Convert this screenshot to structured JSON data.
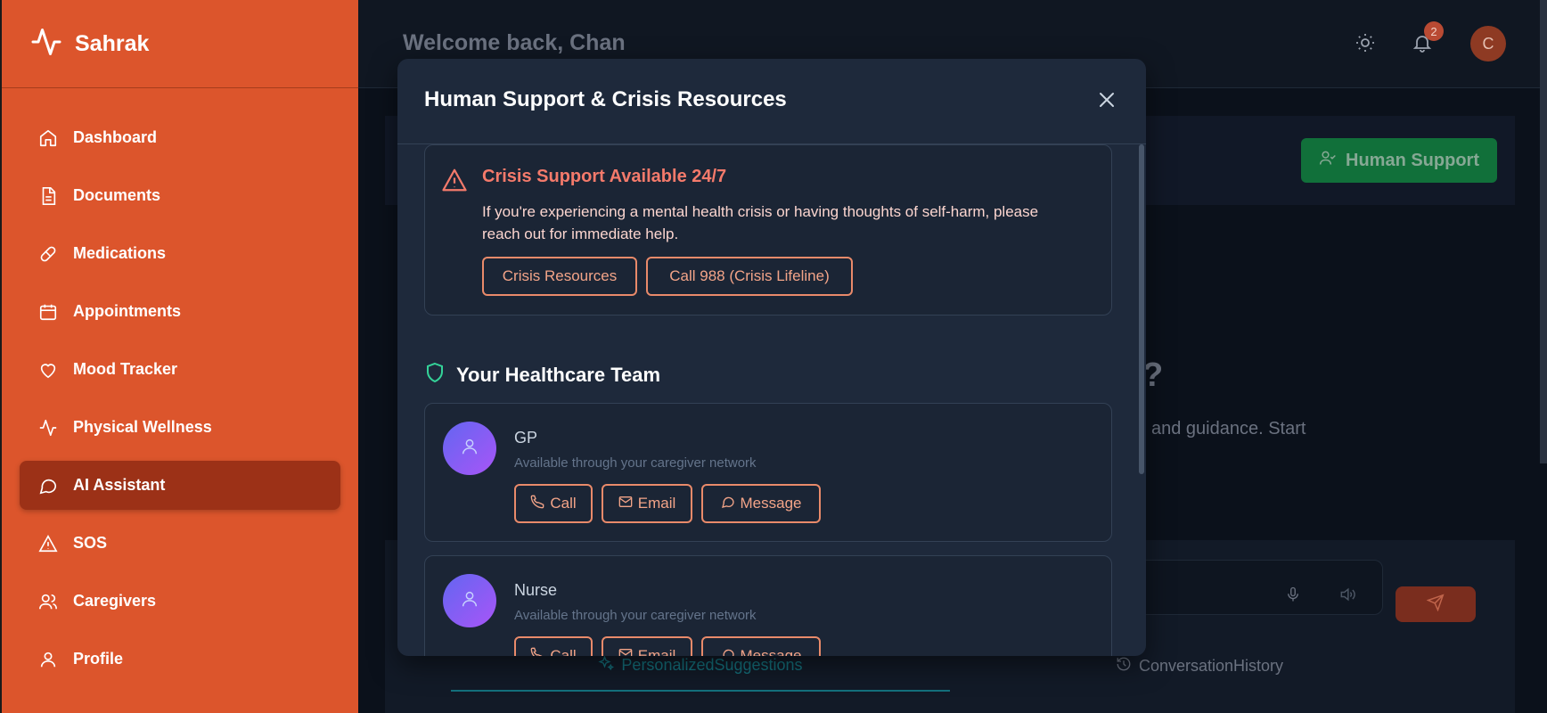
{
  "brand": {
    "name": "Sahrak",
    "icon": "pulse-icon"
  },
  "sidebar": {
    "items": [
      {
        "label": "Dashboard",
        "icon": "home-icon",
        "active": false
      },
      {
        "label": "Documents",
        "icon": "document-icon",
        "active": false
      },
      {
        "label": "Medications",
        "icon": "pill-icon",
        "active": false
      },
      {
        "label": "Appointments",
        "icon": "calendar-icon",
        "active": false
      },
      {
        "label": "Mood Tracker",
        "icon": "heart-icon",
        "active": false
      },
      {
        "label": "Physical Wellness",
        "icon": "pulse-icon",
        "active": false
      },
      {
        "label": "AI Assistant",
        "icon": "chat-icon",
        "active": true
      },
      {
        "label": "SOS",
        "icon": "warning-icon",
        "active": false
      },
      {
        "label": "Caregivers",
        "icon": "users-icon",
        "active": false
      },
      {
        "label": "Profile",
        "icon": "user-icon",
        "active": false
      }
    ]
  },
  "header": {
    "welcome": "Welcome back, Chan",
    "notification_count": "2",
    "avatar_initial": "C"
  },
  "main": {
    "human_support_label": "Human Support",
    "question_fragment": "?",
    "guidance_fragment": "and guidance. Start",
    "tabs": [
      {
        "label": "PersonalizedSuggestions",
        "active": true
      },
      {
        "label": "ConversationHistory",
        "active": false
      }
    ]
  },
  "modal": {
    "title": "Human Support & Crisis Resources",
    "crisis": {
      "title": "Crisis Support Available 24/7",
      "text": "If you're experiencing a mental health crisis or having thoughts of self-harm, please reach out for immediate help.",
      "resources_label": "Crisis Resources",
      "call_label": "Call 988 (Crisis Lifeline)"
    },
    "team_heading": "Your Healthcare Team",
    "members": [
      {
        "name": "GP",
        "subtitle": "Available through your caregiver network",
        "call": "Call",
        "email": "Email",
        "message": "Message"
      },
      {
        "name": "Nurse",
        "subtitle": "Available through your caregiver network",
        "call": "Call",
        "email": "Email",
        "message": "Message"
      }
    ]
  },
  "colors": {
    "sidebar": "#dc552c",
    "sidebar_active": "#9c3117",
    "modal_bg": "#1e293b",
    "crisis_accent": "#f47a6b",
    "support_green": "#11703a",
    "teal_tab": "#14707c"
  }
}
